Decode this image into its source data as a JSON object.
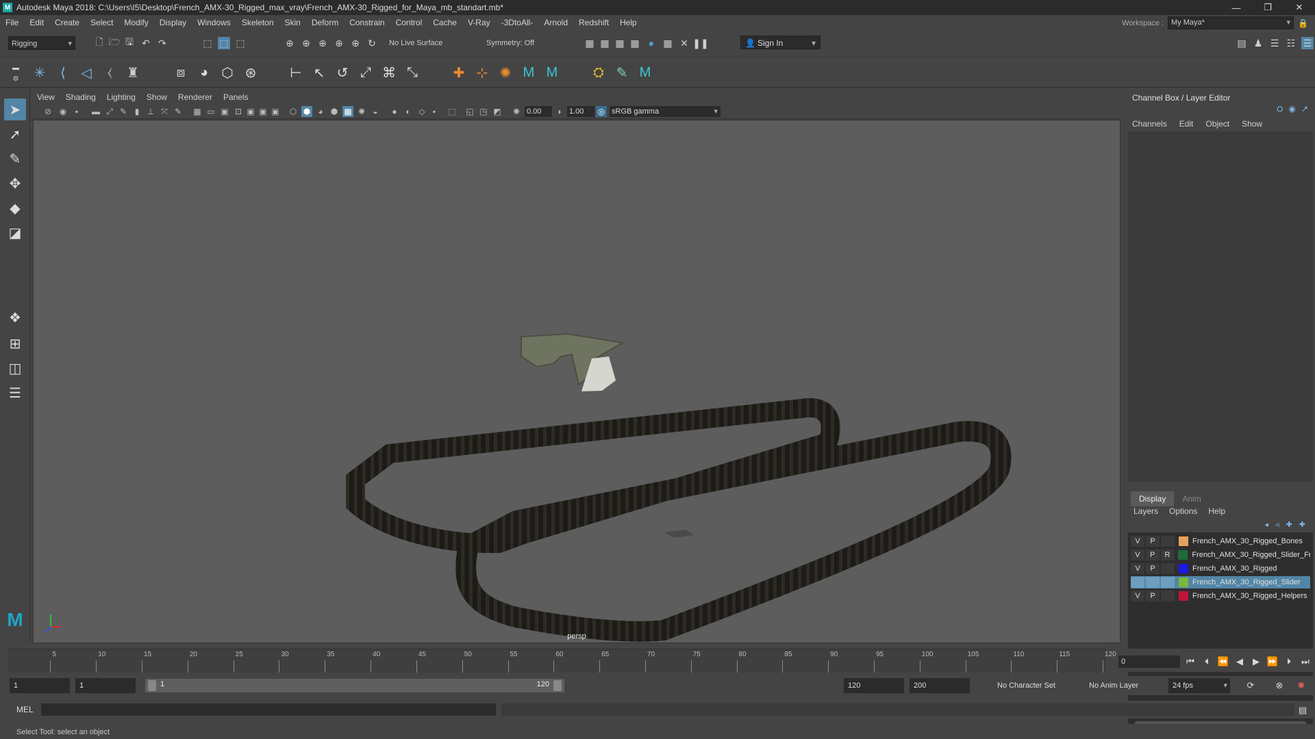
{
  "window": {
    "title": "Autodesk Maya 2018: C:\\Users\\I5\\Desktop\\French_AMX-30_Rigged_max_vray\\French_AMX-30_Rigged_for_Maya_mb_standart.mb*",
    "app_icon": "M"
  },
  "menu": [
    "File",
    "Edit",
    "Create",
    "Select",
    "Modify",
    "Display",
    "Windows",
    "Skeleton",
    "Skin",
    "Deform",
    "Constrain",
    "Control",
    "Cache",
    "V-Ray",
    "-3DtoAll-",
    "Arnold",
    "Redshift",
    "Help"
  ],
  "workspace": {
    "label": "Workspace :",
    "value": "My Maya*"
  },
  "statusline": {
    "mode": "Rigging",
    "live_surface": "No Live Surface",
    "symmetry": "Symmetry: Off",
    "sign_in": "Sign In"
  },
  "viewport": {
    "menu": [
      "View",
      "Shading",
      "Lighting",
      "Show",
      "Renderer",
      "Panels"
    ],
    "exposure": "0.00",
    "gamma": "1.00",
    "color_space": "sRGB gamma",
    "camera_label": "persp"
  },
  "channel_box": {
    "title": "Channel Box / Layer Editor",
    "tabs": [
      "Channels",
      "Edit",
      "Object",
      "Show"
    ]
  },
  "layer_editor": {
    "tabs": [
      "Display",
      "Anim"
    ],
    "menu": [
      "Layers",
      "Options",
      "Help"
    ],
    "layers": [
      {
        "v": "V",
        "p": "P",
        "r": "",
        "name": "French_AMX_30_Rigged_Bones",
        "color": "#e8a060",
        "selected": false
      },
      {
        "v": "V",
        "p": "P",
        "r": "R",
        "name": "French_AMX_30_Rigged_Slider_Fr",
        "color": "#1f6b3a",
        "selected": false
      },
      {
        "v": "V",
        "p": "P",
        "r": "",
        "name": "French_AMX_30_Rigged",
        "color": "#1a1ae0",
        "selected": false
      },
      {
        "v": "",
        "p": "",
        "r": "",
        "name": "French_AMX_30_Rigged_Slider",
        "color": "#7ab83a",
        "selected": true
      },
      {
        "v": "V",
        "p": "P",
        "r": "",
        "name": "French_AMX_30_Rigged_Helpers",
        "color": "#c0143c",
        "selected": false
      }
    ]
  },
  "timeline": {
    "ticks": [
      5,
      10,
      15,
      20,
      25,
      30,
      35,
      40,
      45,
      50,
      55,
      60,
      65,
      70,
      75,
      80,
      85,
      90,
      95,
      100,
      105,
      110,
      115,
      120
    ],
    "current_frame": "0"
  },
  "range": {
    "start": "1",
    "playback_start": "1",
    "slider_start": "1",
    "slider_end": "120",
    "playback_end": "120",
    "end": "200",
    "character_set": "No Character Set",
    "anim_layer": "No Anim Layer",
    "fps": "24 fps"
  },
  "command_line": {
    "label": "MEL"
  },
  "help_line": {
    "text": "Select Tool: select an object"
  }
}
